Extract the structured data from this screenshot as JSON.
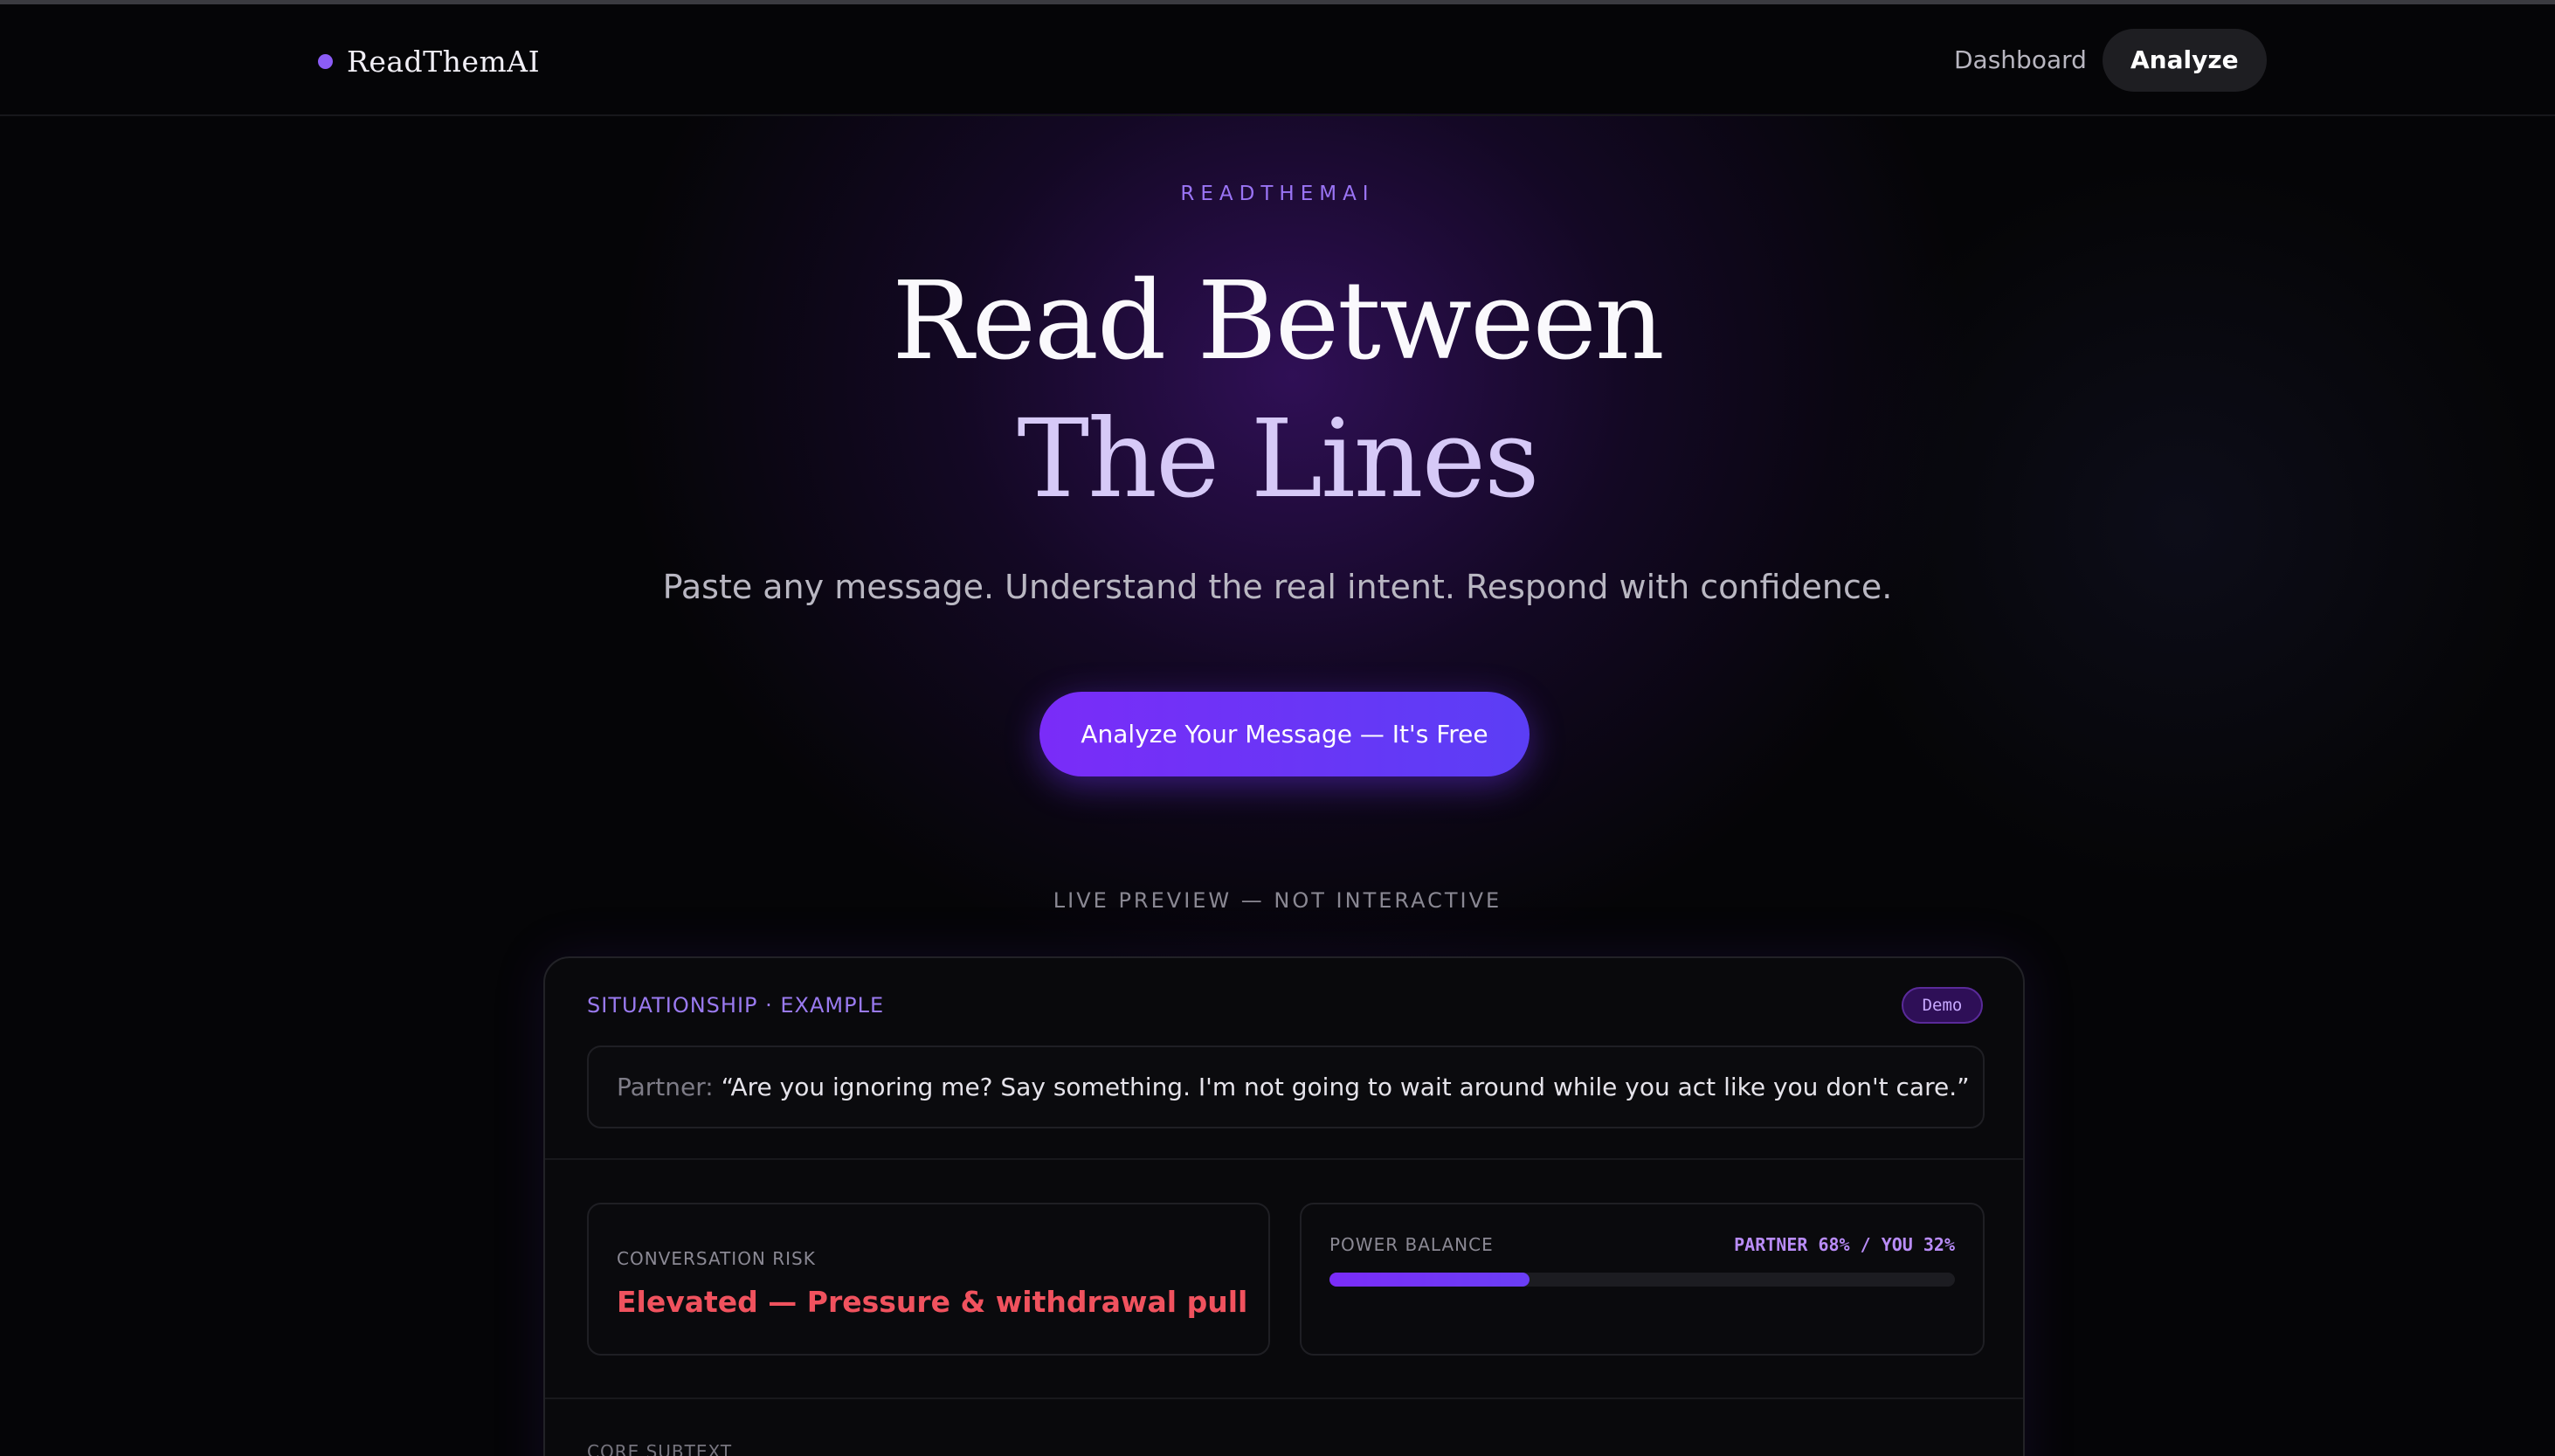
{
  "nav": {
    "brand": "ReadThemAI",
    "links": [
      {
        "label": "Dashboard",
        "active": false
      },
      {
        "label": "Analyze",
        "active": true
      }
    ]
  },
  "hero": {
    "eyebrow": "READTHEMAI",
    "headline_line1": "Read Between",
    "headline_line2": "The Lines",
    "subhead": "Paste any message. Understand the real intent. Respond with confidence.",
    "cta_label": "Analyze Your Message — It's Free"
  },
  "preview": {
    "label": "LIVE PREVIEW — NOT INTERACTIVE",
    "tag": "SITUATIONSHIP · EXAMPLE",
    "badge": "Demo",
    "quote_speaker": "Partner:",
    "quote_text": "“Are you ignoring me? Say something. I'm not going to wait around while you act like you don't care.”",
    "risk_label": "CONVERSATION RISK",
    "risk_value": "Elevated — Pressure & withdrawal pull",
    "power_label": "POWER BALANCE",
    "power_readout": "PARTNER 68% / YOU 32%",
    "power_you_fraction": 0.32,
    "core_label": "CORE SUBTEXT"
  },
  "colors": {
    "accent": "#8b5cf6",
    "cta_start": "#7a2cf8",
    "cta_end": "#5b3ef5",
    "risk": "#f0525e",
    "background": "#050507"
  },
  "icons": {
    "brand_mark": "brand-dot-icon"
  }
}
